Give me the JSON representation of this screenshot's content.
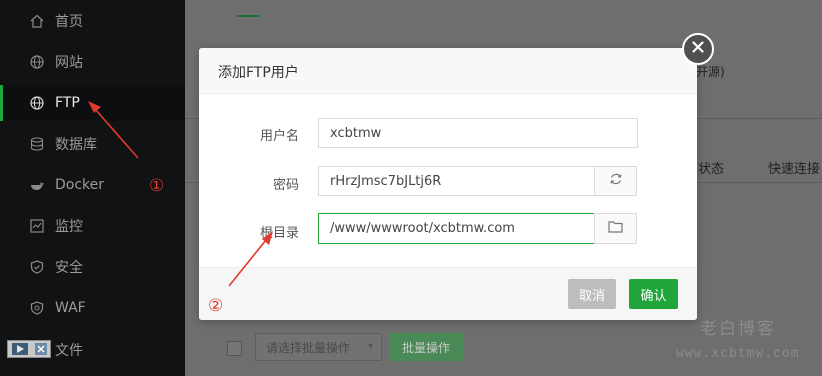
{
  "sidebar": {
    "items": [
      {
        "label": "首页",
        "icon": "home-icon"
      },
      {
        "label": "网站",
        "icon": "globe-icon"
      },
      {
        "label": "FTP",
        "icon": "ftp-globe-icon",
        "active": true
      },
      {
        "label": "数据库",
        "icon": "database-icon"
      },
      {
        "label": "Docker",
        "icon": "docker-icon"
      },
      {
        "label": "监控",
        "icon": "monitor-icon"
      },
      {
        "label": "安全",
        "icon": "shield-icon"
      },
      {
        "label": "WAF",
        "icon": "waf-shield-icon"
      },
      {
        "label": "文件",
        "icon": "folder-icon"
      }
    ]
  },
  "background": {
    "open_source_fragment": "开源)",
    "col_status": "状态",
    "col_quick_connect": "快速连接",
    "bulk_select_placeholder": "请选择批量操作",
    "bulk_button": "批量操作"
  },
  "dialog": {
    "title": "添加FTP用户",
    "username_label": "用户名",
    "username_value": "xcbtmw",
    "password_label": "密码",
    "password_value": "rHrzJmsc7bJLtj6R",
    "root_label": "根目录",
    "root_value": "/www/wwwroot/xcbtmw.com",
    "cancel_label": "取消",
    "confirm_label": "确认"
  },
  "annotations": {
    "marker1": "①",
    "marker2": "②",
    "color": "#e03b2e"
  },
  "watermark": {
    "line1": "老白博客",
    "line2": "www.xcbtmw.com"
  },
  "colors": {
    "accent": "#20a53a",
    "sidebar_bg": "#101214"
  }
}
